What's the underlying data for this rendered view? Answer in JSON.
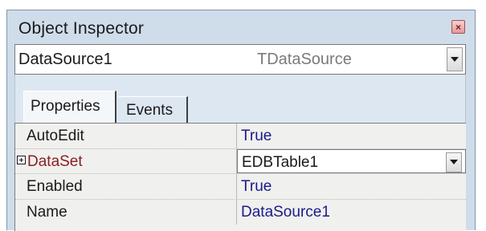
{
  "window": {
    "title": "Object Inspector"
  },
  "component_selector": {
    "name": "DataSource1",
    "type": "TDataSource"
  },
  "tabs": [
    {
      "label": "Properties",
      "active": true
    },
    {
      "label": "Events",
      "active": false
    }
  ],
  "properties": [
    {
      "name": "AutoEdit",
      "value": "True"
    },
    {
      "name": "DataSet",
      "value": "EDBTable1",
      "expandable": true,
      "selected": true
    },
    {
      "name": "Enabled",
      "value": "True"
    },
    {
      "name": "Name",
      "value": "DataSource1"
    }
  ],
  "colors": {
    "window_bg": "#cfdcea",
    "value_text": "#1a1a8c",
    "selected_name_text": "#8a1f1f"
  },
  "icons": {
    "close": "close-icon",
    "dropdown": "chevron-down-icon",
    "expand": "plus-box-icon"
  }
}
